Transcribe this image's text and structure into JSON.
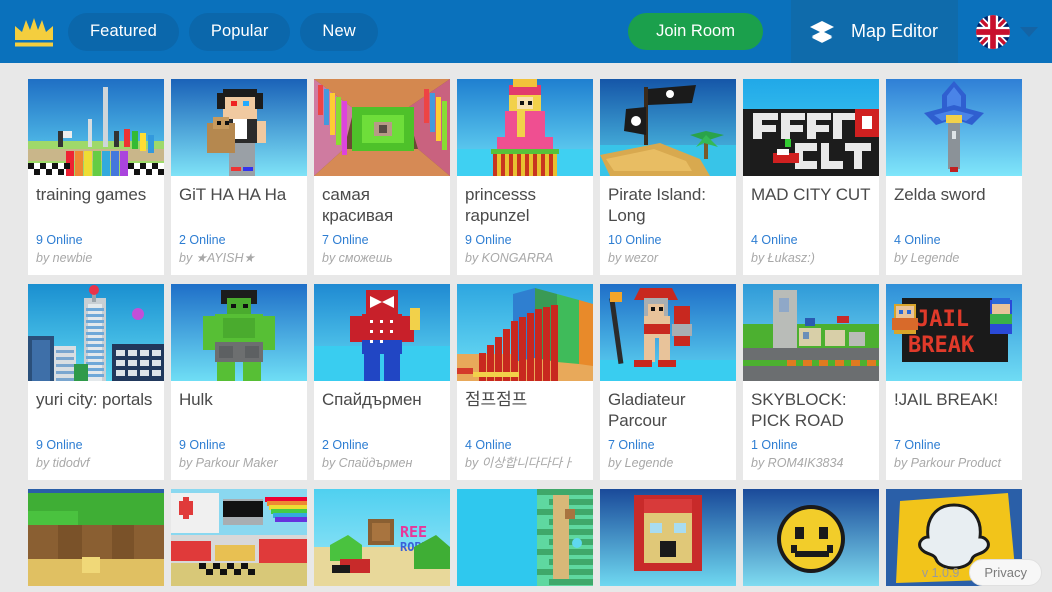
{
  "header": {
    "logo_icon": "crown-icon",
    "tabs": [
      {
        "label": "Featured"
      },
      {
        "label": "Popular"
      },
      {
        "label": "New"
      }
    ],
    "join_room_label": "Join Room",
    "layers_icon": "layers-icon",
    "map_editor_label": "Map Editor",
    "language_flag": "united-kingdom-flag-icon",
    "language_caret": "chevron-down-icon",
    "colors": {
      "bar": "#0a71bc",
      "tab": "#0b67ab",
      "join_room": "#1ba04c",
      "map_editor_panel": "#0f6bab",
      "crown": "#f4ce3e"
    }
  },
  "cards": [
    {
      "title": "training games",
      "online": "9 Online",
      "author": "by newbie",
      "thumb": "training-games-thumb"
    },
    {
      "title": "GiT HA HA Ha",
      "online": "2 Online",
      "author": "by ★AYISH★",
      "thumb": "git-ha-ha-ha-thumb"
    },
    {
      "title": "самая красивая",
      "online": "7 Online",
      "author": "by сможешь",
      "thumb": "samaya-krasivaya-thumb"
    },
    {
      "title": "princesss rapunzel",
      "online": "9 Online",
      "author": "by KONGARRA",
      "thumb": "princess-rapunzel-thumb"
    },
    {
      "title": "Pirate Island: Long",
      "online": "10 Online",
      "author": "by wezor",
      "thumb": "pirate-island-thumb"
    },
    {
      "title": "MAD CITY CUT",
      "online": "4 Online",
      "author": "by Łukasz:)",
      "thumb": "mad-city-cut-thumb"
    },
    {
      "title": "Zelda sword",
      "online": "4 Online",
      "author": "by Legende",
      "thumb": "zelda-sword-thumb"
    },
    {
      "title": "yuri city: portals",
      "online": "9 Online",
      "author": "by tidodvf",
      "thumb": "yuri-city-portals-thumb"
    },
    {
      "title": "Hulk",
      "online": "9 Online",
      "author": "by Parkour Maker",
      "thumb": "hulk-thumb"
    },
    {
      "title": "Спайдърмен",
      "online": "2 Online",
      "author": "by Спайдърмен",
      "thumb": "spiderman-thumb"
    },
    {
      "title": "점프점프",
      "online": "4 Online",
      "author": "by 이상합니다다다ㅏ",
      "thumb": "jump-jump-thumb"
    },
    {
      "title": "Gladiateur Parcour",
      "online": "7 Online",
      "author": "by Legende",
      "thumb": "gladiateur-parcour-thumb"
    },
    {
      "title": "SKYBLOCK: PICK ROAD",
      "online": "1 Online",
      "author": "by ROM4IK3834",
      "thumb": "skyblock-pick-road-thumb"
    },
    {
      "title": "!JAIL BREAK!",
      "online": "7 Online",
      "author": "by Parkour Product",
      "thumb": "jail-break-thumb"
    },
    {
      "title": "",
      "online": "",
      "author": "",
      "thumb": "forest-thumb",
      "partial": true
    },
    {
      "title": "",
      "online": "",
      "author": "",
      "thumb": "blocks-city-thumb",
      "partial": true
    },
    {
      "title": "",
      "online": "",
      "author": "",
      "thumb": "free-robux-thumb",
      "partial": true
    },
    {
      "title": "",
      "online": "",
      "author": "",
      "thumb": "tower-thumb",
      "partial": true
    },
    {
      "title": "",
      "online": "",
      "author": "",
      "thumb": "red-house-thumb",
      "partial": true
    },
    {
      "title": "",
      "online": "",
      "author": "",
      "thumb": "smiley-thumb",
      "partial": true
    },
    {
      "title": "",
      "online": "",
      "author": "",
      "thumb": "snapchat-thumb",
      "partial": true
    }
  ],
  "footer": {
    "version": "v 1.0.9",
    "privacy_label": "Privacy"
  }
}
